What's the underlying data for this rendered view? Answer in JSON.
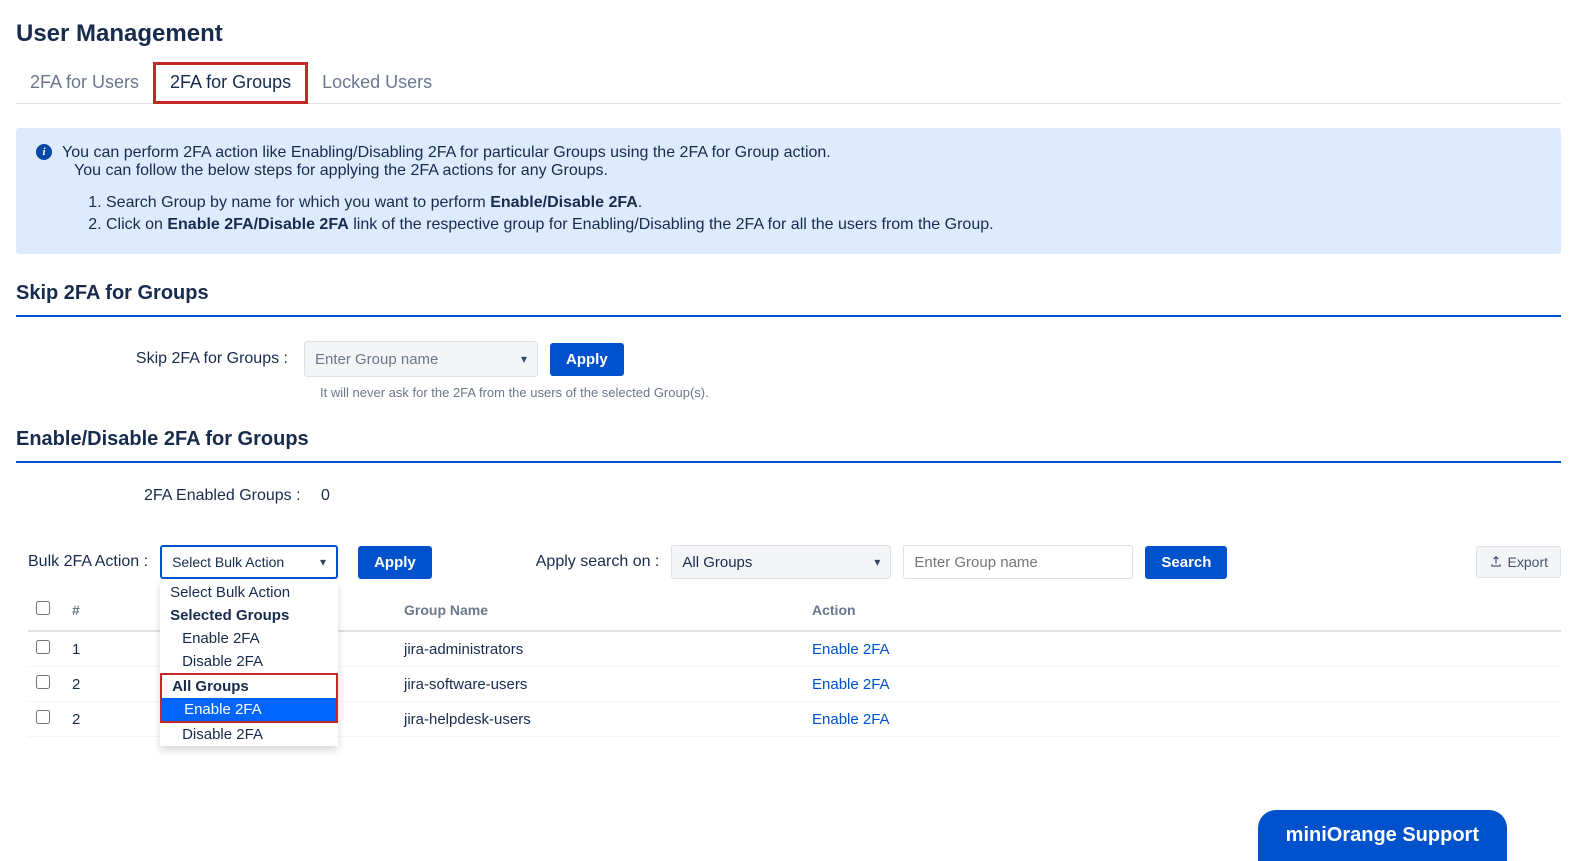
{
  "page_title": "User Management",
  "tabs": [
    {
      "label": "2FA for Users"
    },
    {
      "label": "2FA for Groups"
    },
    {
      "label": "Locked Users"
    }
  ],
  "info": {
    "line1": "You can perform 2FA action like Enabling/Disabling 2FA for particular Groups using the 2FA for Group action.",
    "line2": "You can follow the below steps for applying the 2FA actions for any Groups.",
    "step1_pre": "Search Group by name for which you want to perform ",
    "step1_bold": "Enable/Disable 2FA",
    "step1_post": ".",
    "step2_pre": "Click on ",
    "step2_bold": "Enable 2FA/Disable 2FA",
    "step2_post": " link of the respective group for Enabling/Disabling the 2FA for all the users from the Group."
  },
  "skip_section": {
    "heading": "Skip 2FA for Groups",
    "label": "Skip 2FA for Groups :",
    "placeholder": "Enter Group name",
    "apply": "Apply",
    "hint": "It will never ask for the 2FA from the users of the selected Group(s)."
  },
  "enable_section": {
    "heading": "Enable/Disable 2FA for Groups",
    "count_label": "2FA Enabled Groups :",
    "count_value": "0"
  },
  "bulk_toolbar": {
    "label": "Bulk 2FA Action :",
    "select_value": "Select Bulk Action",
    "apply": "Apply",
    "dropdown": {
      "opt1": "Select Bulk Action",
      "header1": "Selected Groups",
      "opt2": "Enable 2FA",
      "opt3": "Disable 2FA",
      "header2": "All Groups",
      "opt4": "Enable 2FA",
      "opt5": "Disable 2FA"
    },
    "apply_search_label": "Apply search on :",
    "apply_search_value": "All Groups",
    "search_placeholder": "Enter Group name",
    "search_btn": "Search",
    "export_btn": "Export"
  },
  "table": {
    "col_num": "#",
    "col_name": "Group Name",
    "col_action": "Action",
    "rows": [
      {
        "num": "1",
        "name": "jira-administrators",
        "action": "Enable 2FA"
      },
      {
        "num": "2",
        "name": "jira-software-users",
        "action": "Enable 2FA"
      },
      {
        "num": "2",
        "name": "jira-helpdesk-users",
        "action": "Enable 2FA"
      }
    ]
  },
  "support_tab": "miniOrange Support"
}
